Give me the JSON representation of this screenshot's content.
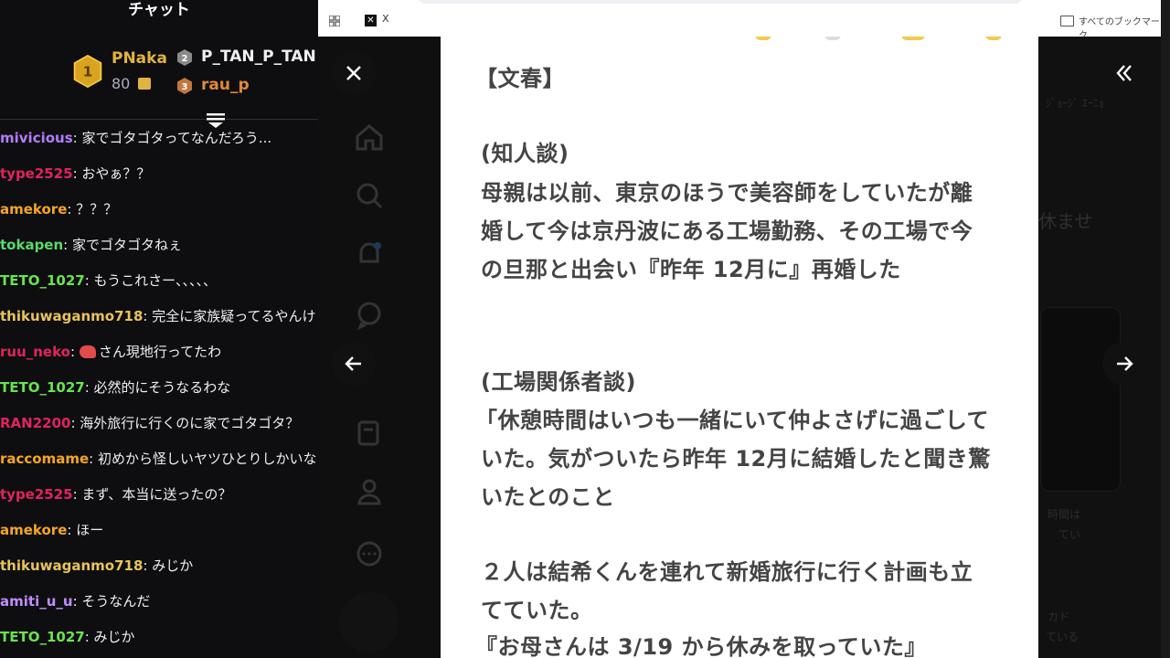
{
  "chat": {
    "title": "チャット",
    "leaderboard": {
      "first": {
        "rank": "1",
        "name": "PNaka",
        "score": "80"
      },
      "second": {
        "rank": "2",
        "name": "P_TAN_P_TAN"
      },
      "third": {
        "rank": "3",
        "name": "rau_p"
      }
    },
    "messages": [
      {
        "user": "mivicious",
        "text": ": 家でゴタゴタってなんだろう...",
        "color": "#b57cff"
      },
      {
        "user": "type2525",
        "text": ": おやぁ？？",
        "color": "#e0245e"
      },
      {
        "user": "amekore",
        "text": ": ？？？",
        "color": "#f5a623"
      },
      {
        "user": "tokapen",
        "text": ": 家でゴタゴタねぇ",
        "color": "#5ad96a"
      },
      {
        "user": "TETO_1027",
        "text": ": もうこれさー、、、、、",
        "color": "#6be34f"
      },
      {
        "user": "thikuwaganmo718",
        "text": ": 完全に家族疑ってるやんけ",
        "color": "#e8c45a"
      },
      {
        "user": "ruu_neko",
        "text": ": さん現地行ってたわ",
        "color": "#e0245e",
        "shrimp": true
      },
      {
        "user": "TETO_1027",
        "text": ": 必然的にそうなるわな",
        "color": "#6be34f"
      },
      {
        "user": "RAN2200",
        "text": ": 海外旅行に行くのに家でゴタゴタ？",
        "color": "#e0245e"
      },
      {
        "user": "raccomame",
        "text": ": 初めから怪しいヤツひとりしかいない",
        "color": "#f5a623"
      },
      {
        "user": "type2525",
        "text": ": まず、本当に送ったの？",
        "color": "#e0245e"
      },
      {
        "user": "amekore",
        "text": ": ほー",
        "color": "#f5a623"
      },
      {
        "user": "thikuwaganmo718",
        "text": ": みじか",
        "color": "#e8c45a"
      },
      {
        "user": "amiti_u_u",
        "text": ": そうなんだ",
        "color": "#c28cff"
      },
      {
        "user": "TETO_1027",
        "text": ": みじか",
        "color": "#6be34f"
      }
    ]
  },
  "browser": {
    "tab_label": "X",
    "bookmarks_label": "すべてのブックマーク"
  },
  "background_ghost": {
    "line1": "休ませ",
    "small1": "ｼﾞｮｰｼﾞ ｴｰﾆｮ",
    "small2": "時間は",
    "small3": "てい",
    "small4": "カド",
    "small5": "ている"
  },
  "document": {
    "lines": [
      "【文春】",
      "(知人談)",
      "母親は以前、東京のほうで美容師をしていたが離",
      "婚して今は京丹波にある工場勤務、その工場で今",
      "の旦那と出会い『昨年 12月に』再婚した",
      "(工場関係者談)",
      "「休憩時間はいつも一緒にいて仲よさげに過ごして",
      "いた。気がついたら昨年 12月に結婚したと聞き驚",
      "いたとのこと",
      "２人は結希くんを連れて新婚旅行に行く計画も立",
      "てていた。",
      "『お母さんは 3/19 から休みを取っていた』"
    ]
  },
  "icons": {
    "close": "close-icon",
    "collapse": "double-chevron-left-icon",
    "prev": "arrow-left-icon",
    "next": "arrow-right-icon"
  }
}
